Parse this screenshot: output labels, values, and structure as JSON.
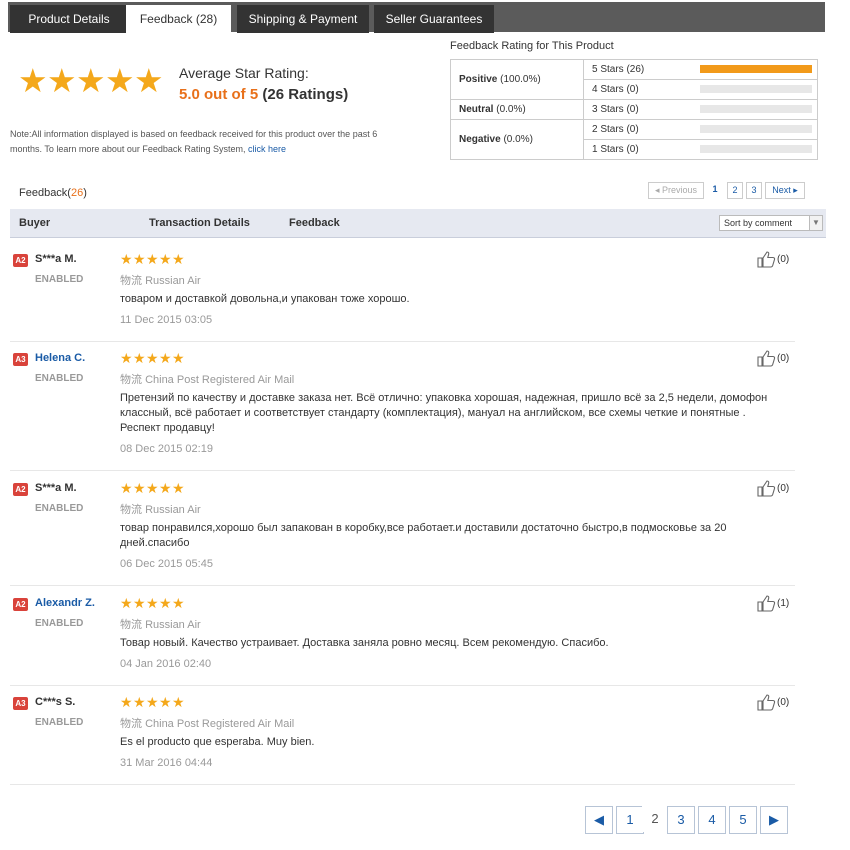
{
  "tabs": [
    {
      "label": "Product Details"
    },
    {
      "label": "Feedback (28)"
    },
    {
      "label": "Shipping & Payment"
    },
    {
      "label": "Seller Guarantees"
    }
  ],
  "summary": {
    "title": "Average Star Rating:",
    "score": "5.0 out of 5",
    "count": "(26 Ratings)",
    "star_color": "#f4a81b",
    "note_text": "Note:All information displayed is based on feedback received for this product over the past 6 months. To learn more about our Feedback Rating System, ",
    "note_link": "click here"
  },
  "rating_table": {
    "title": "Feedback Rating for This Product",
    "categories": [
      {
        "name": "Positive",
        "pct": "(100.0%)"
      },
      {
        "name": "Neutral",
        "pct": "(0.0%)"
      },
      {
        "name": "Negative",
        "pct": "(0.0%)"
      }
    ],
    "stars": [
      {
        "label": "5 Stars (26)",
        "fraction": 1.0
      },
      {
        "label": "4 Stars (0)",
        "fraction": 0
      },
      {
        "label": "3 Stars (0)",
        "fraction": 0
      },
      {
        "label": "2 Stars (0)",
        "fraction": 0
      },
      {
        "label": "1 Stars (0)",
        "fraction": 0
      }
    ]
  },
  "feedback_header": {
    "label": "Feedback(",
    "count": "26",
    "close": ")"
  },
  "pager_top": {
    "prev": "◂ Previous",
    "pages": [
      "1",
      "2",
      "3"
    ],
    "next": "Next ▸"
  },
  "table_header": {
    "buyer": "Buyer",
    "transaction": "Transaction Details",
    "feedback": "Feedback",
    "sort": "Sort by comment",
    "sort_arrow": "▼"
  },
  "reviews": [
    {
      "badge": "A2",
      "buyer": "S***a M.",
      "status": "ENABLED",
      "rating": 5,
      "ship_prefix": "物流",
      "shipping": "Russian Air",
      "text": "товаром и доставкой довольна,и упакован тоже хорошо.",
      "date": "11 Dec 2015 03:05",
      "helpful": "(0)"
    },
    {
      "badge": "A3",
      "buyer": "Helena C.",
      "status": "ENABLED",
      "rating": 5,
      "ship_prefix": "物流",
      "shipping": "China Post Registered Air Mail",
      "text": "Претензий по качеству и доставке заказа нет. Всё отлично: упаковка хорошая, надежная, пришло всё за 2,5 недели, домофон классный, всё работает и соответствует стандарту (комплектация), мануал на английском, все схемы четкие и понятные . Респект продавцу!",
      "date": "08 Dec 2015 02:19",
      "helpful": "(0)"
    },
    {
      "badge": "A2",
      "buyer": "S***a M.",
      "status": "ENABLED",
      "rating": 5,
      "ship_prefix": "物流",
      "shipping": "Russian Air",
      "text": "товар понравился,хорошо был запакован в коробку,все работает.и доставили достаточно быстро,в подмосковье за 20 дней.спасибо",
      "date": "06 Dec 2015 05:45",
      "helpful": "(0)"
    },
    {
      "badge": "A2",
      "buyer": "Alexandr Z.",
      "status": "ENABLED",
      "rating": 5,
      "ship_prefix": "物流",
      "shipping": "Russian Air",
      "text": "Товар новый. Качество устраивает. Доставка заняла ровно месяц. Всем рекомендую. Спасибо.",
      "date": "04 Jan 2016 02:40",
      "helpful": "(1)"
    },
    {
      "badge": "A3",
      "buyer": "C***s S.",
      "status": "ENABLED",
      "rating": 5,
      "ship_prefix": "物流",
      "shipping": "China Post Registered Air Mail",
      "text": "Es el producto que esperaba. Muy bien.",
      "date": "31 Mar 2016 04:44",
      "helpful": "(0)"
    }
  ],
  "pager_bottom": {
    "prev_icon": "◀",
    "pages": [
      "1",
      "2",
      "3",
      "4",
      "5"
    ],
    "current": "2",
    "next_icon": "▶"
  }
}
